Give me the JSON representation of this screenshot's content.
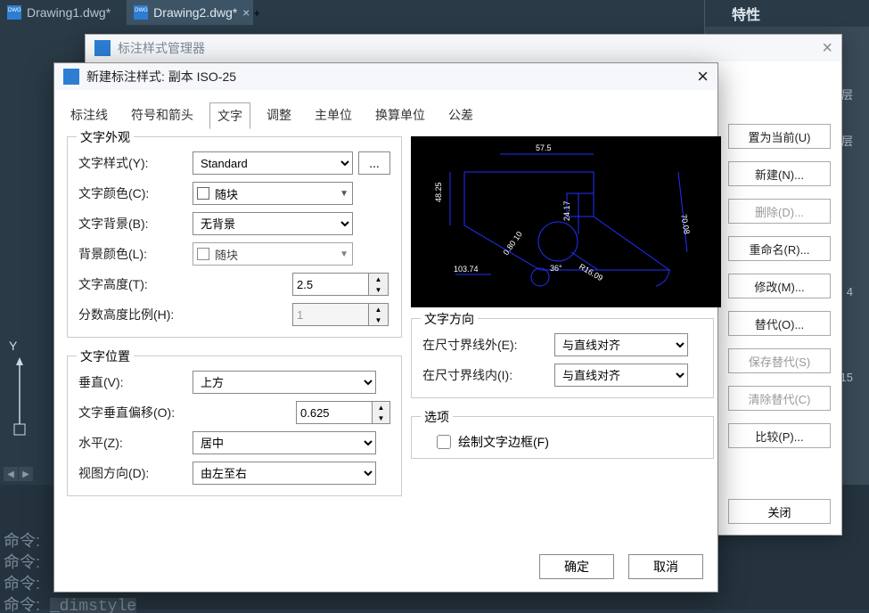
{
  "tabs": {
    "inactive": "Drawing1.dwg*",
    "active": "Drawing2.dwg*"
  },
  "properties_panel": {
    "title": "特性",
    "row1": "图层",
    "row2": "层",
    "row3": "4",
    "row4": "15"
  },
  "cmd": {
    "prefix": "命令:",
    "last": "_dimstyle"
  },
  "axis": {
    "y": "Y"
  },
  "parent_dialog": {
    "title": "标注样式管理器",
    "buttons": {
      "set_current": "置为当前(U)",
      "new": "新建(N)...",
      "delete": "删除(D)...",
      "rename": "重命名(R)...",
      "modify": "修改(M)...",
      "override": "替代(O)...",
      "save_override": "保存替代(S)",
      "clear_override": "清除替代(C)",
      "compare": "比较(P)..."
    },
    "close": "关闭"
  },
  "child_dialog": {
    "title": "新建标注样式: 副本 ISO-25",
    "tabs": [
      "标注线",
      "符号和箭头",
      "文字",
      "调整",
      "主单位",
      "换算单位",
      "公差"
    ],
    "active_tab": 2,
    "appearance": {
      "legend": "文字外观",
      "text_style_label": "文字样式(Y):",
      "text_style_value": "Standard",
      "text_color_label": "文字颜色(C):",
      "text_color_value": "随块",
      "text_bg_label": "文字背景(B):",
      "text_bg_value": "无背景",
      "bg_color_label": "背景颜色(L):",
      "bg_color_value": "随块",
      "text_height_label": "文字高度(T):",
      "text_height_value": "2.5",
      "frac_height_label": "分数高度比例(H):",
      "frac_height_value": "1"
    },
    "placement": {
      "legend": "文字位置",
      "vertical_label": "垂直(V):",
      "vertical_value": "上方",
      "offset_label": "文字垂直偏移(O):",
      "offset_value": "0.625",
      "horizontal_label": "水平(Z):",
      "horizontal_value": "居中",
      "view_dir_label": "视图方向(D):",
      "view_dir_value": "由左至右"
    },
    "direction": {
      "legend": "文字方向",
      "outside_label": "在尺寸界线外(E):",
      "outside_value": "与直线对齐",
      "inside_label": "在尺寸界线内(I):",
      "inside_value": "与直线对齐"
    },
    "options": {
      "legend": "选项",
      "draw_border": "绘制文字边框(F)"
    },
    "ok": "确定",
    "cancel": "取消"
  },
  "preview": {
    "dim1": "57.5",
    "dim2": "48.25",
    "dim3": "24.17",
    "dim4": "70.08",
    "dim5": "103.74",
    "dim6": "R16.09",
    "dim7": "0.80 10",
    "dim8": "36°"
  }
}
